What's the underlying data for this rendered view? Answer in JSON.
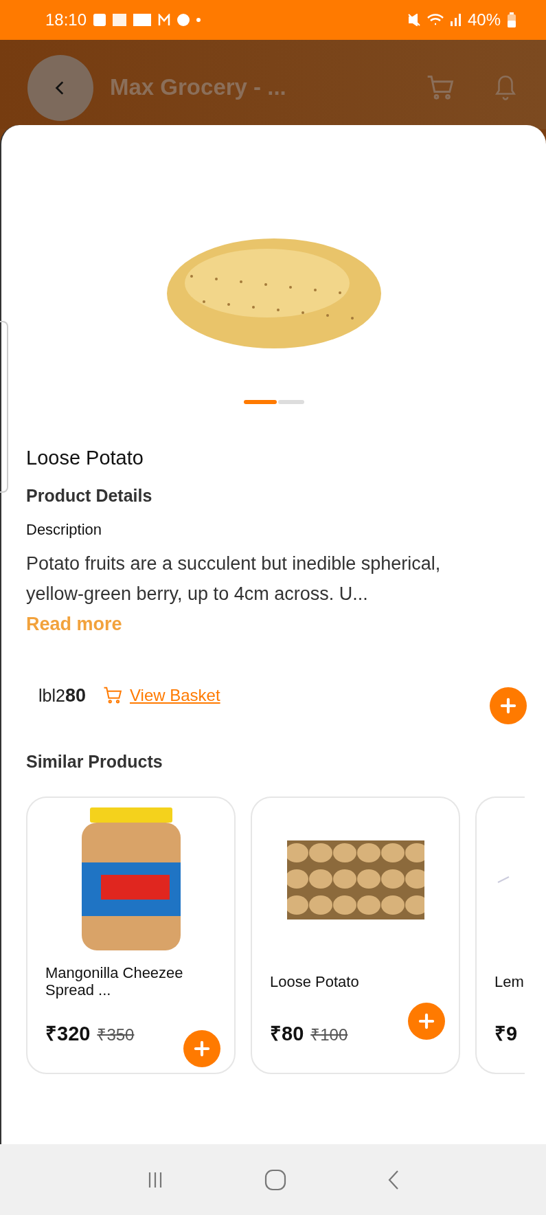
{
  "status_bar": {
    "time": "18:10",
    "battery": "40%"
  },
  "header": {
    "title": "Max Grocery - ..."
  },
  "product": {
    "images": [
      {
        "selected": true
      },
      {
        "selected": false
      }
    ],
    "name": "Loose Potato",
    "section_title": "Product Details",
    "description_label": "Description",
    "description": "Potato fruits are a succulent but inedible spherical, yellow-green berry, up to 4cm across. U...",
    "read_more": "Read more",
    "quantity": "lbl2**80**",
    "view_basket": "View Basket"
  },
  "similar": {
    "title": "Similar Products",
    "items": [
      {
        "kind": "jar",
        "name": "Mangonilla Cheezee Spread ...",
        "price": "₹320",
        "old_price": "₹350"
      },
      {
        "kind": "potatoes",
        "name": "Loose Potato",
        "price": "₹80",
        "old_price": "₹100"
      },
      {
        "kind": "partial",
        "name": "Lem",
        "price": "₹9"
      }
    ]
  }
}
